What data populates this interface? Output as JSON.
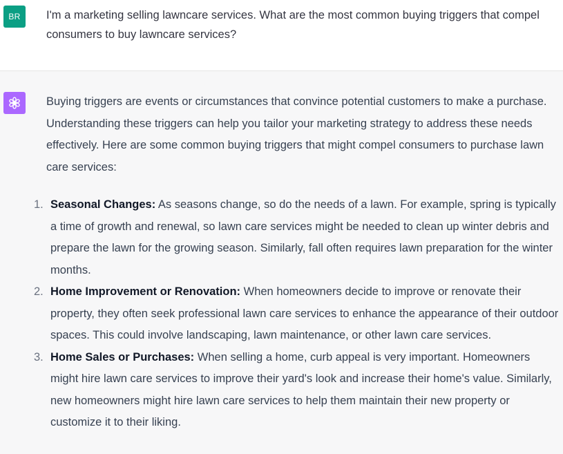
{
  "user": {
    "avatar_initials": "BR",
    "message": "I'm a marketing selling lawncare services. What are the most common buying triggers that compel consumers to buy lawncare services?"
  },
  "assistant": {
    "avatar_icon": "openai-logo-icon",
    "intro": "Buying triggers are events or circumstances that convince potential customers to make a purchase. Understanding these triggers can help you tailor your marketing strategy to address these needs effectively. Here are some common buying triggers that might compel consumers to purchase lawn care services:",
    "items": [
      {
        "number": "1.",
        "title": "Seasonal Changes:",
        "text": " As seasons change, so do the needs of a lawn. For example, spring is typically a time of growth and renewal, so lawn care services might be needed to clean up winter debris and prepare the lawn for the growing season. Similarly, fall often requires lawn preparation for the winter months."
      },
      {
        "number": "2.",
        "title": "Home Improvement or Renovation:",
        "text": " When homeowners decide to improve or renovate their property, they often seek professional lawn care services to enhance the appearance of their outdoor spaces. This could involve landscaping, lawn maintenance, or other lawn care services."
      },
      {
        "number": "3.",
        "title": "Home Sales or Purchases:",
        "text": " When selling a home, curb appeal is very important. Homeowners might hire lawn care services to improve their yard's look and increase their home's value. Similarly, new homeowners might hire lawn care services to help them maintain their new property or customize it to their liking."
      }
    ]
  },
  "colors": {
    "user_avatar": "#0b9f84",
    "assistant_avatar": "#ab68ff",
    "assistant_background": "#f7f7f8"
  }
}
